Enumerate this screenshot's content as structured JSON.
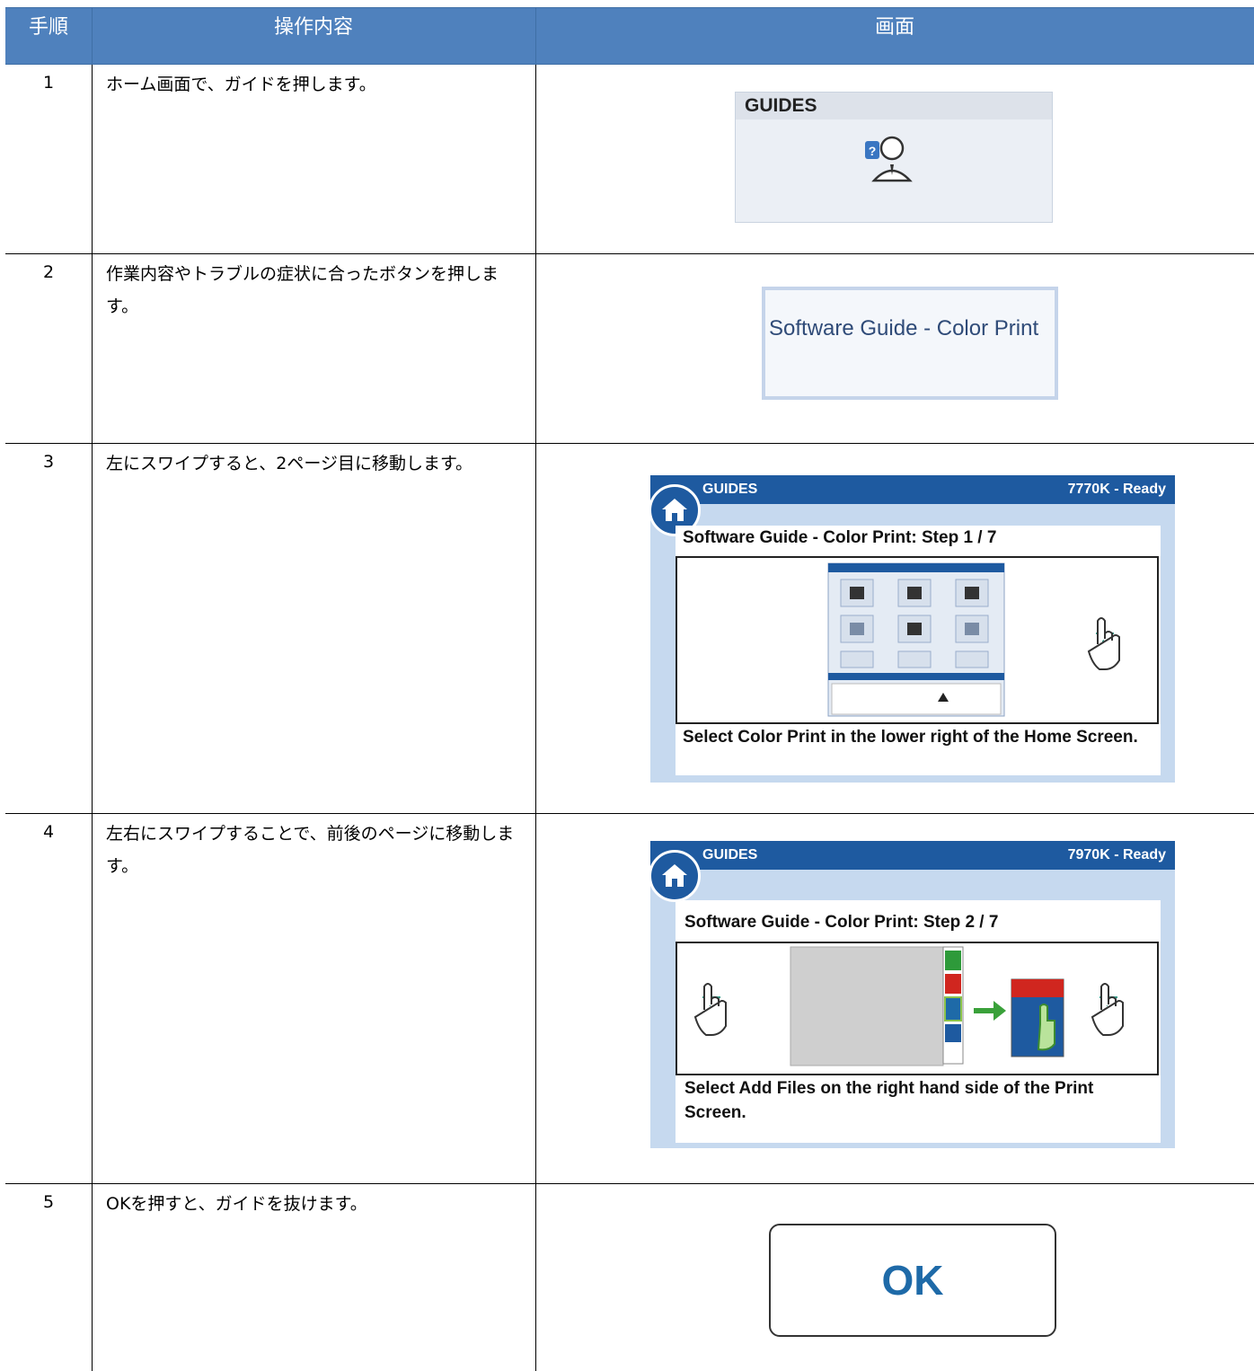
{
  "table": {
    "headers": {
      "step": "手順",
      "operation": "操作内容",
      "screen": "画面"
    },
    "rows": [
      {
        "num": "1",
        "text": "ホーム画面で、ガイドを押します。"
      },
      {
        "num": "2",
        "text": "作業内容やトラブルの症状に合ったボタンを押します。"
      },
      {
        "num": "3",
        "text": "左にスワイプすると、2ページ目に移動します。"
      },
      {
        "num": "4",
        "text": "左右にスワイプすることで、前後のページに移動します。"
      },
      {
        "num": "5",
        "text": "OKを押すと、ガイドを抜けます。"
      }
    ]
  },
  "screens": {
    "guides_tile": {
      "label": "GUIDES"
    },
    "guide_button": {
      "label": "Software Guide - Color Print"
    },
    "page1": {
      "header": "GUIDES",
      "status": "7770K - Ready",
      "title": "Software Guide - Color Print: Step 1 / 7",
      "caption": "Select  Color Print in the lower  right of the Home Screen."
    },
    "page2": {
      "header": "GUIDES",
      "status": "7970K - Ready",
      "title": "Software Guide - Color Print: Step 2 / 7",
      "caption": "Select Add Files on the right hand side of the Print Screen."
    },
    "ok_button": {
      "label": "OK"
    }
  },
  "colors": {
    "header_blue": "#4f81bd",
    "app_blue": "#1e5aa0",
    "ok_blue": "#1e6aa8"
  }
}
